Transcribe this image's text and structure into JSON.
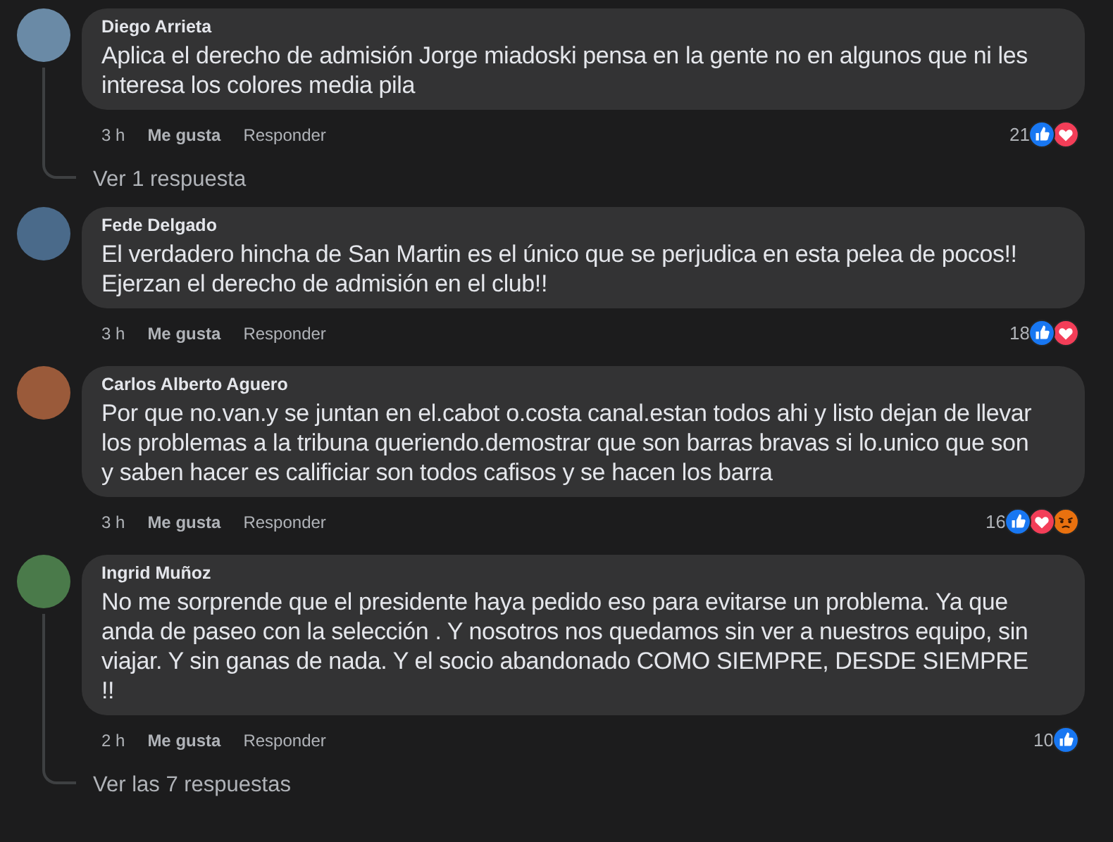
{
  "comments": [
    {
      "author": "Diego Arrieta",
      "text": "Aplica el derecho de admisión Jorge miadoski pensa en la gente no en algunos que ni les interesa los colores media pila",
      "time": "3 h",
      "like_label": "Me gusta",
      "reply_label": "Responder",
      "reaction_count": "21",
      "reactions": [
        {
          "kind": "like"
        },
        {
          "kind": "love"
        }
      ],
      "replies_link": "Ver 1 respuesta"
    },
    {
      "author": "Fede Delgado",
      "text": "El verdadero hincha de San Martin es el único que se perjudica en esta pelea de pocos!! Ejerzan el derecho de admisión en el club!!",
      "time": "3 h",
      "like_label": "Me gusta",
      "reply_label": "Responder",
      "reaction_count": "18",
      "reactions": [
        {
          "kind": "like"
        },
        {
          "kind": "love"
        }
      ]
    },
    {
      "author": "Carlos Alberto Aguero",
      "text": "Por que no.van.y se juntan en el.cabot o.costa canal.estan todos ahi y listo dejan de llevar los problemas a la tribuna queriendo.demostrar que son barras bravas si lo.unico que son y saben hacer es calificiar son todos cafisos y se hacen los barra",
      "time": "3 h",
      "like_label": "Me gusta",
      "reply_label": "Responder",
      "reaction_count": "16",
      "reactions": [
        {
          "kind": "like"
        },
        {
          "kind": "love"
        },
        {
          "kind": "angry"
        }
      ]
    },
    {
      "author": "Ingrid Muñoz",
      "text": "No me sorprende que el presidente haya pedido eso para evitarse un problema. Ya que anda de paseo con la selección . Y nosotros nos quedamos sin ver a nuestros equipo, sin viajar. Y sin ganas de nada. Y el socio abandonado COMO SIEMPRE, DESDE SIEMPRE !!",
      "time": "2 h",
      "like_label": "Me gusta",
      "reply_label": "Responder",
      "reaction_count": "10",
      "reactions": [
        {
          "kind": "like"
        }
      ],
      "replies_link": "Ver las 7 respuestas"
    }
  ]
}
